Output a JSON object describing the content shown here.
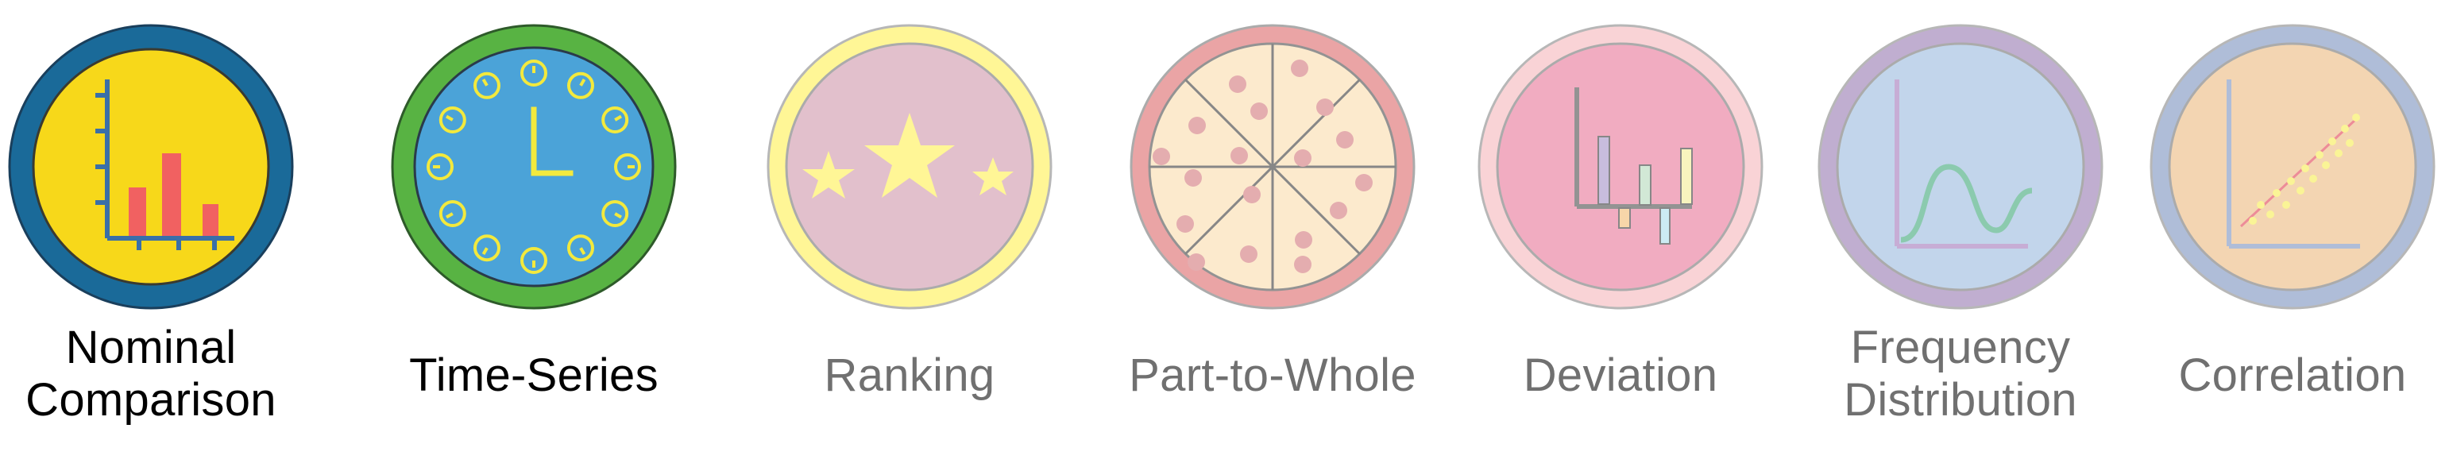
{
  "badges": [
    {
      "id": "nominal",
      "label_lines": [
        "Nominal",
        "Comparison"
      ],
      "state": "active",
      "icon": "bar-chart-icon",
      "ring_color": "#1a6a99",
      "fill_color": "#f7d81a"
    },
    {
      "id": "timeseries",
      "label_lines": [
        "Time-Series"
      ],
      "state": "active",
      "icon": "clock-icon",
      "ring_color": "#58b343",
      "fill_color": "#4ba3d8"
    },
    {
      "id": "ranking",
      "label_lines": [
        "Ranking"
      ],
      "state": "faded",
      "icon": "stars-icon",
      "ring_color": "#fff36b",
      "fill_color": "#d6a6b7"
    },
    {
      "id": "parttowhole",
      "label_lines": [
        "Part-to-Whole"
      ],
      "state": "faded",
      "icon": "pizza-icon",
      "ring_color": "#e27e80",
      "fill_color": "#fbe2b9"
    },
    {
      "id": "deviation",
      "label_lines": [
        "Deviation"
      ],
      "state": "faded",
      "icon": "deviation-chart-icon",
      "ring_color": "#f7c1c5",
      "fill_color": "#ec8aa7"
    },
    {
      "id": "frequency",
      "label_lines": [
        "Frequency",
        "Distribution"
      ],
      "state": "faded",
      "icon": "distribution-curve-icon",
      "ring_color": "#a68cbd",
      "fill_color": "#a9c4e3"
    },
    {
      "id": "correlation",
      "label_lines": [
        "Correlation"
      ],
      "state": "faded",
      "icon": "scatter-plot-icon",
      "ring_color": "#8ea2c8",
      "fill_color": "#efc492"
    }
  ]
}
